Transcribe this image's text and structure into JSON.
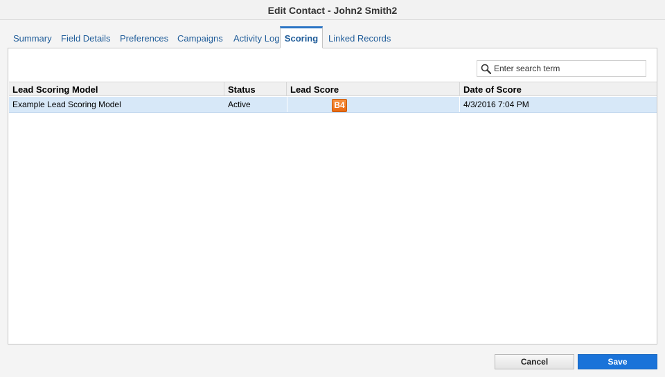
{
  "dialog": {
    "title": "Edit Contact - John2 Smith2"
  },
  "tabs": [
    {
      "label": "Summary"
    },
    {
      "label": "Field Details"
    },
    {
      "label": "Preferences"
    },
    {
      "label": "Campaigns"
    },
    {
      "label": "Activity Log"
    },
    {
      "label": "Scoring",
      "active": true
    },
    {
      "label": "Linked Records"
    }
  ],
  "search": {
    "placeholder": "Enter search term",
    "value": ""
  },
  "table": {
    "columns": [
      "Lead Scoring Model",
      "Status",
      "Lead Score",
      "Date of Score"
    ],
    "rows": [
      {
        "model": "Example Lead Scoring Model",
        "status": "Active",
        "score": "B4",
        "date": "4/3/2016 7:04 PM"
      }
    ]
  },
  "footer": {
    "cancel_label": "Cancel",
    "save_label": "Save"
  },
  "colors": {
    "accent": "#2a74c4",
    "save_button": "#1a73d9",
    "selected_row": "#d7e8f8",
    "score_badge": "#f07c26"
  },
  "icons": {
    "search": "search-icon"
  }
}
